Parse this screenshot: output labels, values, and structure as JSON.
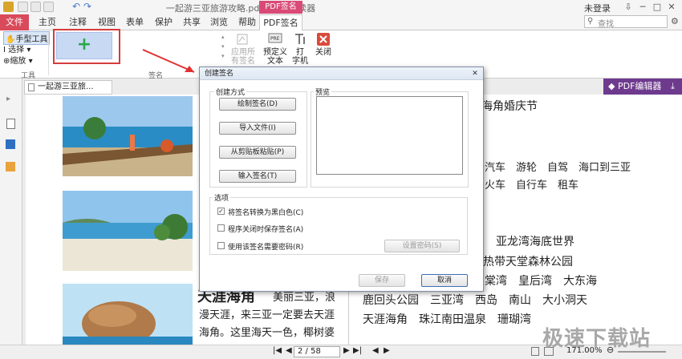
{
  "window": {
    "title": "一起游三亚旅游攻略.pdf - 福昕阅读器",
    "context_tab": "PDF签名",
    "login": "未登录"
  },
  "tabs": [
    "文件",
    "主页",
    "注释",
    "视图",
    "表单",
    "保护",
    "共享",
    "浏览",
    "帮助",
    "PDF签名"
  ],
  "search": {
    "placeholder": "查找"
  },
  "ribbon": {
    "tools": [
      "手型工具",
      "选择",
      "缩放"
    ],
    "tools_group_label": "工具",
    "sig_group_label": "签名",
    "apply_all": "应用所\n有签名",
    "predefined_text": "预定义\n文本",
    "typewriter": "打\n字机",
    "close": "关闭"
  },
  "doc": {
    "tab_title": "一起游三亚旅...",
    "editor_button": "PDF编辑器",
    "right_text": [
      "海角婚庆节",
      "汽车　游轮　自驾　海口到三亚",
      "火车　自行车　租车",
      "亚龙湾海底世界",
      "热带天堂森林公园",
      "棠湾　皇后湾　大东海",
      "鹿回头公园　三亚湾　西岛　南山　大小洞天",
      "天涯海角　珠江南田温泉　珊瑚湾"
    ],
    "left_heading": "天涯海角",
    "left_lines": [
      "美丽三亚，浪",
      "漫天涯，来三亚一定要去天涯",
      "海角。这里海天一色，椰树婆"
    ]
  },
  "status": {
    "page": "2 / 58",
    "zoom": "171.00%"
  },
  "watermark": "极速下载站",
  "dialog": {
    "title": "创建签名",
    "method_label": "创建方式",
    "preview_label": "预览",
    "buttons": [
      "绘制签名(D)",
      "导入文件(I)",
      "从剪贴板粘贴(P)",
      "输入签名(T)"
    ],
    "options_label": "选项",
    "options": [
      {
        "label": "将签名转换为黑白色(C)",
        "checked": true
      },
      {
        "label": "程序关闭时保存签名(A)",
        "checked": false
      },
      {
        "label": "使用该签名需要密码(R)",
        "checked": false
      }
    ],
    "set_password": "设置密码(S)",
    "save": "保存",
    "cancel": "取消"
  },
  "colors": {
    "file_tab": "#d94a5a",
    "context_tab": "#d94a76",
    "editor": "#6e3a8e",
    "highlight_border": "#d63c3c",
    "arrow": "#e03030"
  }
}
